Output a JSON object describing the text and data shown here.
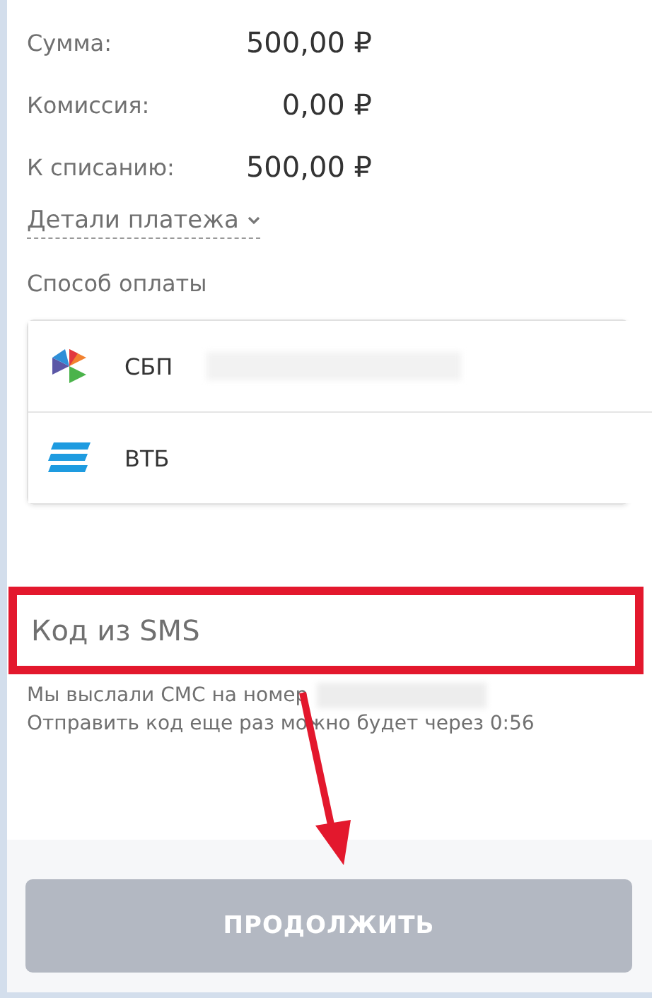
{
  "summary": [
    {
      "label": "Сумма:",
      "value": "500,00 ₽"
    },
    {
      "label": "Комиссия:",
      "value": "0,00 ₽"
    },
    {
      "label": "К списанию:",
      "value": "500,00 ₽"
    }
  ],
  "details_link": {
    "label": "Детали платежа",
    "expanded": false
  },
  "payment_method": {
    "title": "Способ оплаты",
    "options": [
      {
        "kind": "sbp",
        "label": "СБП",
        "blurred": true
      },
      {
        "kind": "vtb",
        "label": "ВТБ",
        "blurred": false
      }
    ]
  },
  "sms": {
    "placeholder": "Код из SMS",
    "sent_note": "Мы выслали СМС на номер",
    "resend_note": "Отправить код еще раз можно будет через 0:56"
  },
  "continue_button": {
    "label": "ПРОДОЛЖИТЬ",
    "disabled": true
  }
}
